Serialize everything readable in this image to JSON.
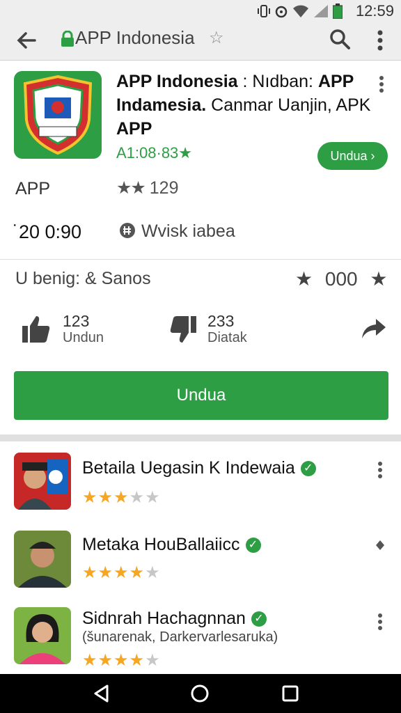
{
  "status": {
    "time": "12:59"
  },
  "topbar": {
    "title": "APP Indonesia",
    "star": "☆"
  },
  "app": {
    "title_bold1": "APP Indonesia",
    "title_part1": " : Nıdban: ",
    "title_bold2": "APP Indamesia.",
    "title_part2": " Canmar Uanjin, APK",
    "title_bold3": "APP",
    "meta": "A1:08·83",
    "meta_star": "★",
    "install_small": "Undu⁠a ›"
  },
  "info": {
    "type": "APP",
    "rating_count": "129",
    "date": "˙20 0:90",
    "website": "Wvisk iabea",
    "developer": "U benig: & Sanos",
    "score": "000"
  },
  "votes": {
    "up_count": "123",
    "up_label": "Undun",
    "down_count": "233",
    "down_label": "Diatak"
  },
  "install_button": "Undu⁠a",
  "reviews": [
    {
      "name": "Betaila Uegasin K Indewaia",
      "subtitle": "",
      "stars": 3
    },
    {
      "name": "Metaka HouBallaiicc",
      "subtitle": "",
      "stars": 4
    },
    {
      "name": "Sidnrah Hachagnnan",
      "subtitle": "(šunarenak, Darkervarlesaruka)",
      "stars": 4
    }
  ]
}
